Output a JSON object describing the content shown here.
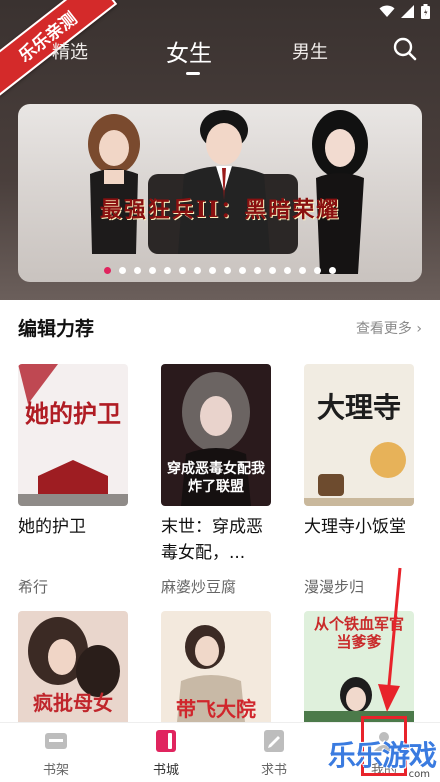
{
  "watermark": {
    "ribbon_text": "乐乐亲测",
    "logo_text": "乐乐游戏",
    "logo_url": "com"
  },
  "top_nav": {
    "tabs": [
      {
        "label": "精选",
        "active": false
      },
      {
        "label": "女生",
        "active": true
      },
      {
        "label": "男生",
        "active": false
      }
    ]
  },
  "banner": {
    "title": "最强狂兵II：黑暗荣耀",
    "slide_count": 16,
    "active_index": 0
  },
  "section": {
    "title": "编辑力荐",
    "more_label": "查看更多"
  },
  "books_row1": [
    {
      "title": "她的护卫",
      "author": "希行",
      "cover_text": "她的护卫",
      "cover_color": "#f4efef"
    },
    {
      "title": "末世：穿成恶毒女配，...",
      "author": "麻婆炒豆腐",
      "cover_text": "穿成恶毒女配我炸了联盟",
      "cover_color": "#2a1a1c"
    },
    {
      "title": "大理寺小饭堂",
      "author": "漫漫步归",
      "cover_text": "大理寺",
      "cover_color": "#f1ece2"
    }
  ],
  "books_row2": [
    {
      "cover_text": "疯批母女",
      "cover_color": "#e9d6cc"
    },
    {
      "cover_text": "带飞大院",
      "cover_color": "#f3e9dd"
    },
    {
      "cover_text": "从个铁血军官当爹爹",
      "cover_color": "#dff0dc"
    }
  ],
  "bottom_nav": [
    {
      "label": "书架",
      "icon": "bookshelf-icon",
      "active": false
    },
    {
      "label": "书城",
      "icon": "bookstore-icon",
      "active": true
    },
    {
      "label": "求书",
      "icon": "request-book-icon",
      "active": false
    },
    {
      "label": "我的",
      "icon": "profile-icon",
      "active": false
    }
  ],
  "colors": {
    "accent": "#e0245e",
    "annotation": "#e8232b",
    "header_bg": "#3a3230"
  }
}
